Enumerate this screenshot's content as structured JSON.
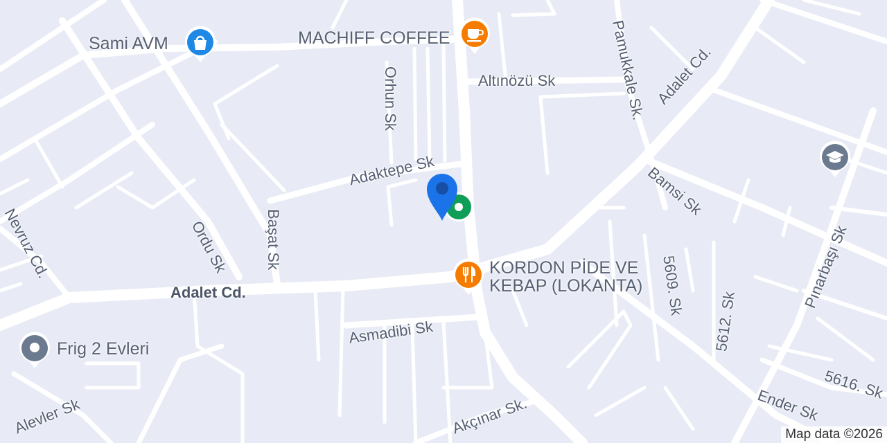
{
  "map": {
    "streets": {
      "adalet_cd_main": "Adalet Cd.",
      "adalet_cd_ne": "Adalet Cd.",
      "orhun_sk": "Orhun Sk",
      "adaktepe_sk": "Adaktepe Sk",
      "altinozu_sk": "Altınözü Sk",
      "pamukkale_sk": "Pamukkale Sk.",
      "bamsi_sk": "Bamsi Sk",
      "nevruz_cd": "Nevruz Cd.",
      "ordu_sk": "Ordu Sk",
      "basat_sk": "Başat Sk",
      "sk_5609": "5609. Sk",
      "sk_5612": "5612. Sk",
      "pinarbasi_sk": "Pınarbaşı Sk",
      "asmadibi_sk": "Asmadibi Sk",
      "sk_5616": "5616. Sk",
      "ender_sk": "Ender Sk",
      "alevler_sk": "Alevler Sk",
      "akcinar_sk": "Akçınar Sk."
    },
    "pois": {
      "sami_avm": {
        "name": "Sami AVM",
        "icon": "shopping-bag-icon",
        "color": "#1e88e5"
      },
      "machiff": {
        "name": "MACHIFF COFFEE",
        "icon": "coffee-cup-icon",
        "color": "#f57c00"
      },
      "kordon_line1": "KORDON PİDE VE",
      "kordon_line2": "KEBAP (LOKANTA)",
      "kordon": {
        "icon": "restaurant-icon",
        "color": "#f57c00"
      },
      "frig": {
        "name": "Frig 2 Evleri",
        "icon": "place-icon",
        "color": "#6b7a8f"
      },
      "school": {
        "icon": "graduation-cap-icon",
        "color": "#6b7a8f"
      },
      "green_place": {
        "icon": "place-icon",
        "color": "#0f9d58"
      }
    },
    "marker": {
      "icon": "location-pin-icon",
      "color": "#1a73e8"
    },
    "attribution": "Map data ©2026"
  }
}
